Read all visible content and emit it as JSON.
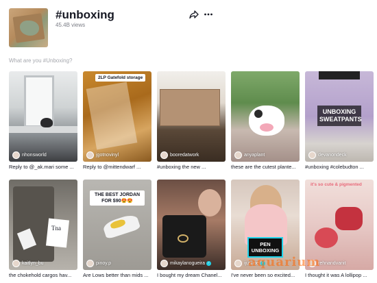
{
  "header": {
    "hashtag": "#unboxing",
    "views": "45.4B views"
  },
  "question": "What are you #Unboxing?",
  "icons": {
    "share": "share-arrow-icon",
    "more": "more-dots-icon"
  },
  "videos": [
    {
      "author": "nhonsworld",
      "caption": "Reply to @_ak.mari some ...",
      "verified": false
    },
    {
      "author": "jgotnovinyl",
      "caption": "Reply to @mittendwarf ...",
      "verified": false,
      "overlay": "2LP Gatefold storage"
    },
    {
      "author": "booredatwork",
      "caption": "#unboxing the new ...",
      "verified": false
    },
    {
      "author": "anyaplant",
      "caption": "these are the cutest plante...",
      "verified": false
    },
    {
      "author": "devanondeck",
      "caption": "#unboxing #colebudton ...",
      "verified": false,
      "overlay": "UNBOXING SWEATPANTS"
    },
    {
      "author": "kaitlyn_bu",
      "caption": "the chokehold cargos hav...",
      "verified": false,
      "overlay": "Tna"
    },
    {
      "author": "pinoy.p",
      "caption": "Are Lows better than mids ...",
      "verified": false,
      "overlay": "THE BEST JORDAN FOR $90😍😍"
    },
    {
      "author": "mikaylanogueira",
      "caption": "I bought my dream Chanel...",
      "verified": true
    },
    {
      "author": "ijustine",
      "caption": "I've never been so excited...",
      "verified": true,
      "overlay": "PEN UNBOXING"
    },
    {
      "author": "rehnandvanit",
      "caption": "I thought it was A lollipop ...",
      "verified": false,
      "overlay": "it's so cute & pigmented"
    }
  ],
  "watermark": "aquarium"
}
